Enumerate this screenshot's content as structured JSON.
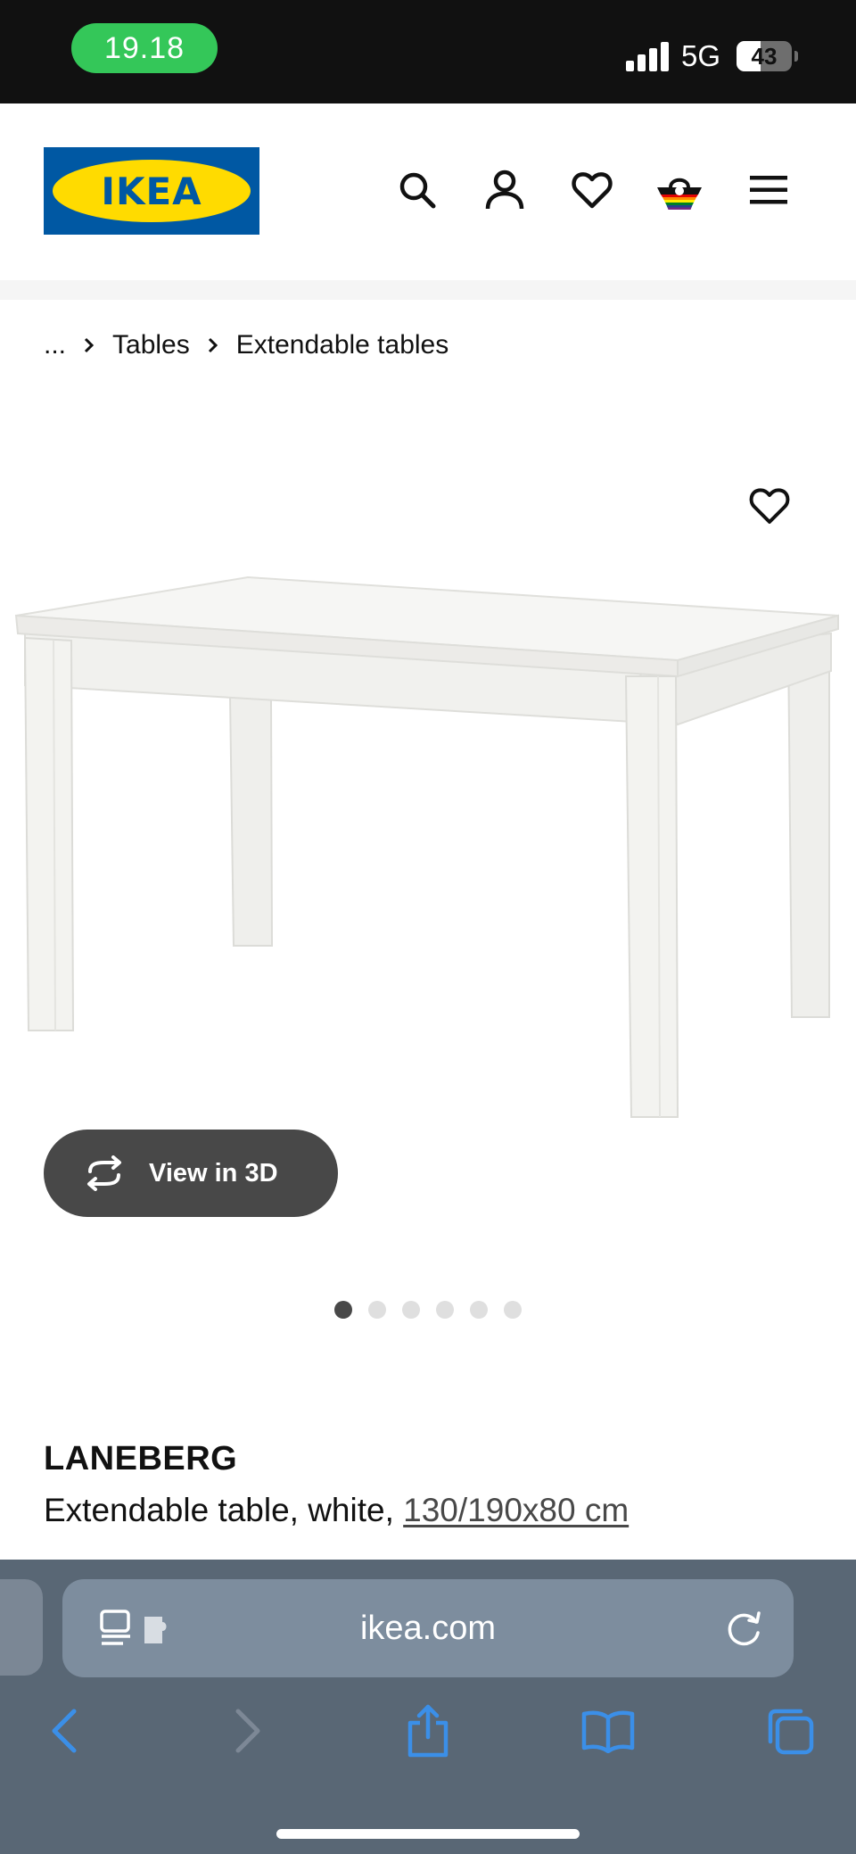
{
  "status_bar": {
    "time": "19.18",
    "network": "5G",
    "battery_percent": "43",
    "battery_level": 0.43
  },
  "header": {
    "logo_text": "IKEA",
    "icons": [
      "search-icon",
      "account-icon",
      "favourites-icon",
      "basket-icon",
      "menu-icon"
    ]
  },
  "breadcrumb": {
    "ellipsis": "...",
    "items": [
      "Tables",
      "Extendable tables"
    ]
  },
  "gallery": {
    "view_3d_label": "View in 3D",
    "image_count": 6,
    "active_index": 0
  },
  "product": {
    "name": "LANEBERG",
    "description": "Extendable table, white,",
    "dimensions": "130/190x80 cm"
  },
  "browser": {
    "url": "ikea.com",
    "tint_color": "#3b8fe8"
  },
  "colors": {
    "ikea_blue": "#0058a3",
    "ikea_yellow": "#ffdb00",
    "status_green": "#34c759"
  }
}
